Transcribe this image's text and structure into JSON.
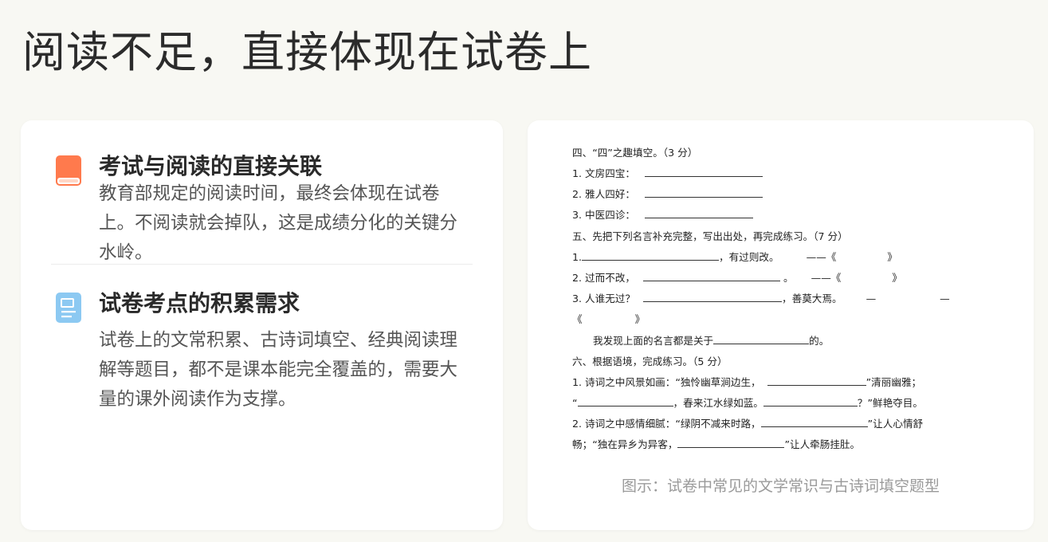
{
  "page": {
    "title": "阅读不足，直接体现在试卷上"
  },
  "left_panel": {
    "sections": [
      {
        "icon": "book-icon",
        "title": "考试与阅读的直接关联",
        "text": "教育部规定的阅读时间，最终会体现在试卷上。不阅读就会掉队，这是成绩分化的关键分水岭。"
      },
      {
        "icon": "document-icon",
        "title": "试卷考点的积累需求",
        "text": "试卷上的文常积累、古诗词填空、经典阅读理解等题目，都不是课本能完全覆盖的，需要大量的课外阅读作为支撑。"
      }
    ]
  },
  "exam": {
    "lines": [
      {
        "a": "四、“四”之趣填空。（3 分）"
      },
      {
        "a": "1. 文房四宝："
      },
      {
        "a": "2. 雅人四好："
      },
      {
        "a": "3. 中医四诊："
      },
      {
        "a": "五、先把下列名言补充完整，写出出处，再完成练习。（7 分）"
      },
      {
        "a": "1.",
        "b": "，有过则改。",
        "c": "——《",
        "d": "》"
      },
      {
        "a": "2. 过而不改，",
        "b": "。",
        "c": "——《",
        "d": "》"
      },
      {
        "a": "3. 人谁无过？",
        "b": "，善莫大焉。",
        "c": "—",
        "d": "—"
      },
      {
        "a": "《",
        "b": "》"
      },
      {
        "a": "我发现上面的名言都是关于",
        "b": "的。"
      },
      {
        "a": "六、根据语境，完成练习。（5 分）"
      },
      {
        "a": "1. 诗词之中风景如画：“独怜幽草涧边生，",
        "b": "”清丽幽雅；"
      },
      {
        "a": "“",
        "b": "，春来江水绿如蓝。",
        "c": "？”鲜艳夺目。"
      },
      {
        "a": "2. 诗词之中感情细腻：“绿阴不减来时路，",
        "b": "”让人心情舒"
      },
      {
        "a": "畅；“独在异乡为异客，",
        "b": "”让人牵肠挂肚。"
      }
    ],
    "caption": "图示：试卷中常见的文学常识与古诗词填空题型"
  },
  "colors": {
    "book_icon": "#ff7a4d",
    "document_icon": "#8cc9f2",
    "background": "#f8f8f3"
  }
}
